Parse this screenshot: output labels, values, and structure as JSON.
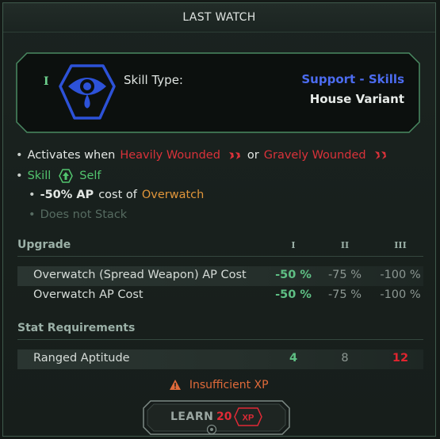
{
  "panel": {
    "title": "LAST WATCH"
  },
  "skill": {
    "tier_mark": "I",
    "type_label": "Skill Type:",
    "category": "Support - Skills",
    "variant": "House Variant",
    "icon": "eye-tear-icon"
  },
  "effects": {
    "activates_prefix": "Activates when",
    "condition_1": "Heavily Wounded",
    "or_word": "or",
    "condition_2": "Gravely Wounded",
    "skill_word": "Skill",
    "self_word": "Self",
    "ap_mod": "-50% AP",
    "cost_of": "cost of",
    "target_skill": "Overwatch",
    "stack_note": "Does not Stack"
  },
  "upgrade": {
    "title": "Upgrade",
    "columns": [
      "I",
      "II",
      "III"
    ],
    "rows": [
      {
        "label": "Overwatch (Spread Weapon) AP Cost",
        "values": [
          "-50 %",
          "-75 %",
          "-100 %"
        ]
      },
      {
        "label": "Overwatch AP Cost",
        "values": [
          "-50 %",
          "-75 %",
          "-100 %"
        ]
      }
    ]
  },
  "stat_requirements": {
    "title": "Stat Requirements",
    "rows": [
      {
        "label": "Ranged Aptitude",
        "values": [
          "4",
          "8",
          "12"
        ]
      }
    ]
  },
  "warning": {
    "text": "Insufficient XP"
  },
  "learn": {
    "label": "LEARN",
    "cost": "20",
    "badge": "XP"
  },
  "colors": {
    "category_blue": "#4c6cf0",
    "wound_red": "#d9323a",
    "skill_green": "#52c46e",
    "overwatch_orange": "#e0953a",
    "warning_orange": "#e06a3a",
    "cost_red": "#e02a36"
  }
}
